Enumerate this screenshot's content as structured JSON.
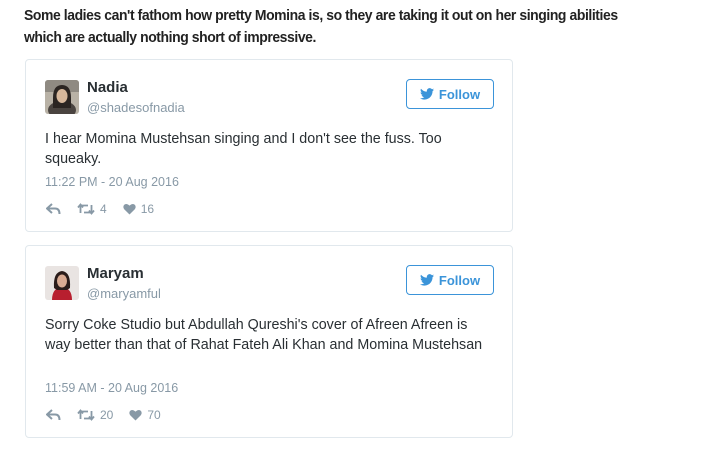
{
  "intro": "Some ladies can't fathom how pretty Momina is, so they are taking it out on her singing abilities which are actually nothing short of impressive.",
  "colors": {
    "twitter_blue": "#3b94d9",
    "meta_gray": "#8899a6",
    "border": "#e1e8ed"
  },
  "tweets": [
    {
      "name": "Nadia",
      "handle": "@shadesofnadia",
      "follow_label": "Follow",
      "text": "I hear Momina Mustehsan singing and I don't see the fuss. Too squeaky.",
      "timestamp": "11:22 PM - 20 Aug 2016",
      "retweets": "4",
      "likes": "16",
      "icons": [
        "reply-icon",
        "retweet-icon",
        "heart-icon",
        "twitter-bird-icon"
      ]
    },
    {
      "name": "Maryam",
      "handle": "@maryamful",
      "follow_label": "Follow",
      "text": "Sorry Coke Studio but Abdullah Qureshi's cover of Afreen Afreen is way better than that of Rahat Fateh Ali Khan and Momina Mustehsan",
      "timestamp": "11:59 AM - 20 Aug 2016",
      "retweets": "20",
      "likes": "70",
      "icons": [
        "reply-icon",
        "retweet-icon",
        "heart-icon",
        "twitter-bird-icon"
      ]
    }
  ]
}
